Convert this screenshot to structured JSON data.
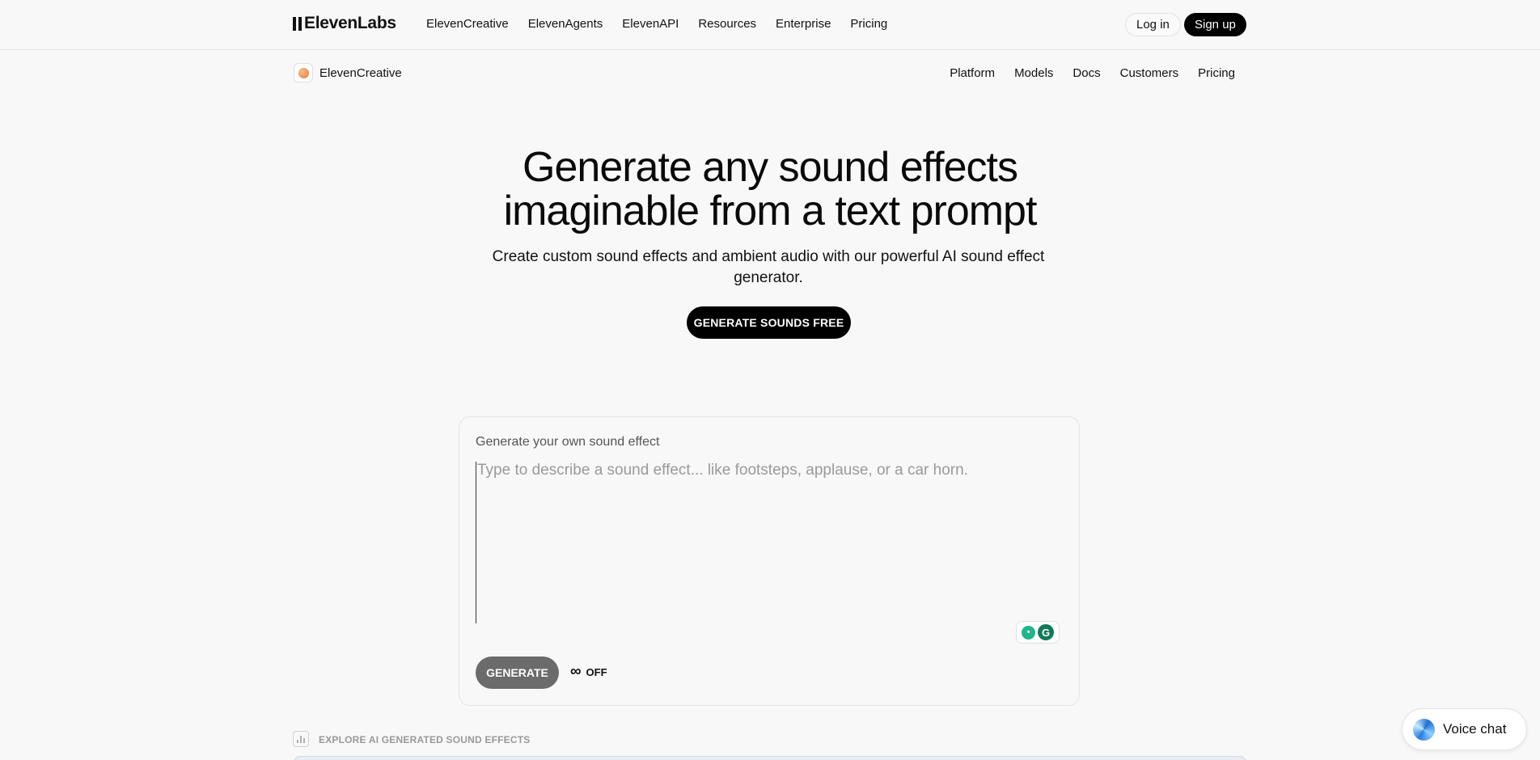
{
  "topnav": {
    "logo": "ElevenLabs",
    "links": [
      "ElevenCreative",
      "ElevenAgents",
      "ElevenAPI",
      "Resources",
      "Enterprise",
      "Pricing"
    ],
    "login_label": "Log in",
    "signup_label": "Sign up"
  },
  "subnav": {
    "product_name": "ElevenCreative",
    "links": [
      "Platform",
      "Models",
      "Docs",
      "Customers",
      "Pricing"
    ]
  },
  "hero": {
    "title_line1": "Generate any sound effects",
    "title_line2": "imaginable from a text prompt",
    "subtitle": "Create custom sound effects and ambient audio with our powerful AI sound effect generator.",
    "cta_label": "GENERATE SOUNDS FREE"
  },
  "generator": {
    "label": "Generate your own sound effect",
    "placeholder": "Type to describe a sound effect... like footsteps, applause, or a car horn.",
    "value": "",
    "generate_label": "GENERATE",
    "loop_symbol": "∞",
    "loop_state": "OFF"
  },
  "explore": {
    "label": "EXPLORE AI GENERATED SOUND EFFECTS"
  },
  "voice_chat": {
    "label": "Voice chat"
  }
}
